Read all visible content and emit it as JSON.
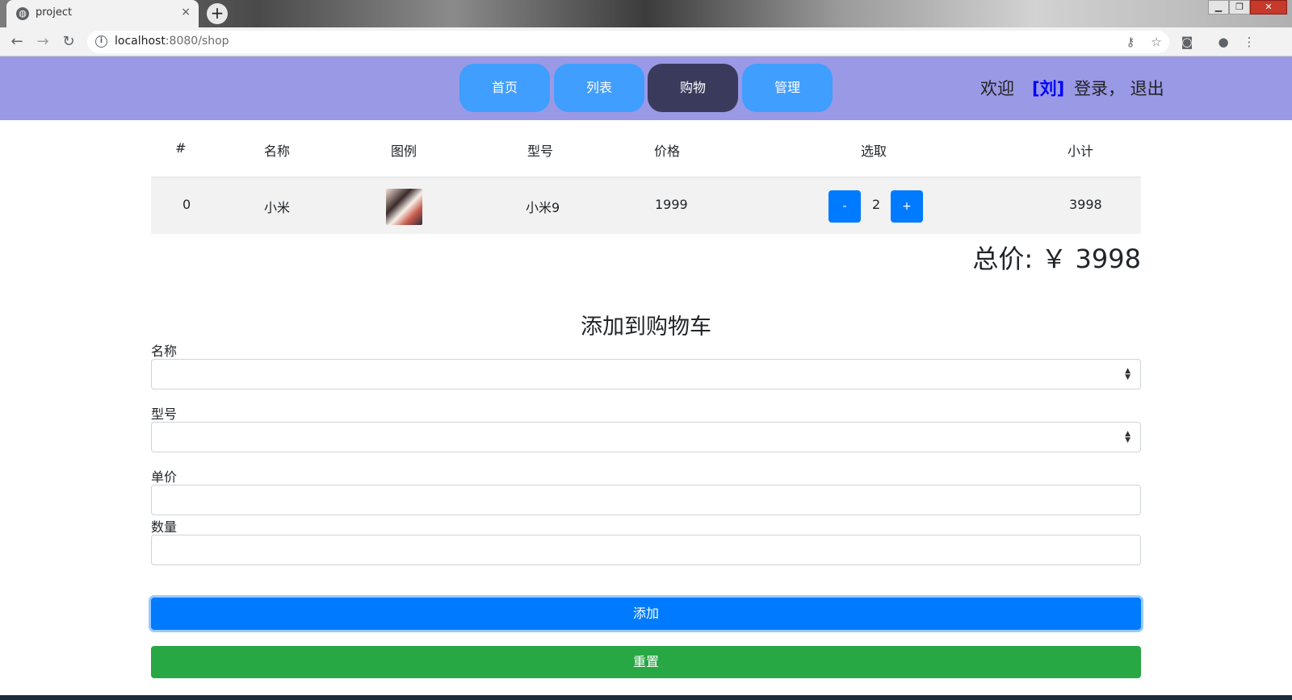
{
  "browser": {
    "tab_title": "project",
    "tab_close": "×",
    "new_tab": "+",
    "url_host": "localhost",
    "url_rest": ":8080/shop",
    "info": "i"
  },
  "header": {
    "nav": [
      "首页",
      "列表",
      "购物",
      "管理"
    ],
    "active_nav": "购物",
    "welcome": "欢迎",
    "user": "[刘]",
    "login_logout": "登录， 退出"
  },
  "table": {
    "headers": [
      "#",
      "名称",
      "图例",
      "型号",
      "价格",
      "选取",
      "小计"
    ],
    "rows": [
      {
        "index": "0",
        "name": "小米",
        "model": "小米9",
        "price": "1999",
        "qty": "2",
        "minus": "-",
        "plus": "+",
        "subtotal": "3998"
      }
    ]
  },
  "total": "总价: ￥ 3998",
  "form": {
    "title": "添加到购物车",
    "name_label": "名称",
    "model_label": "型号",
    "price_label": "单价",
    "qty_label": "数量",
    "add_button": "添加",
    "reset_button": "重置"
  },
  "colors": {
    "header_bg": "#9999e6",
    "nav_pill": "#409eff",
    "nav_active": "#3a3a5c",
    "primary": "#007bff",
    "success": "#28a745"
  }
}
